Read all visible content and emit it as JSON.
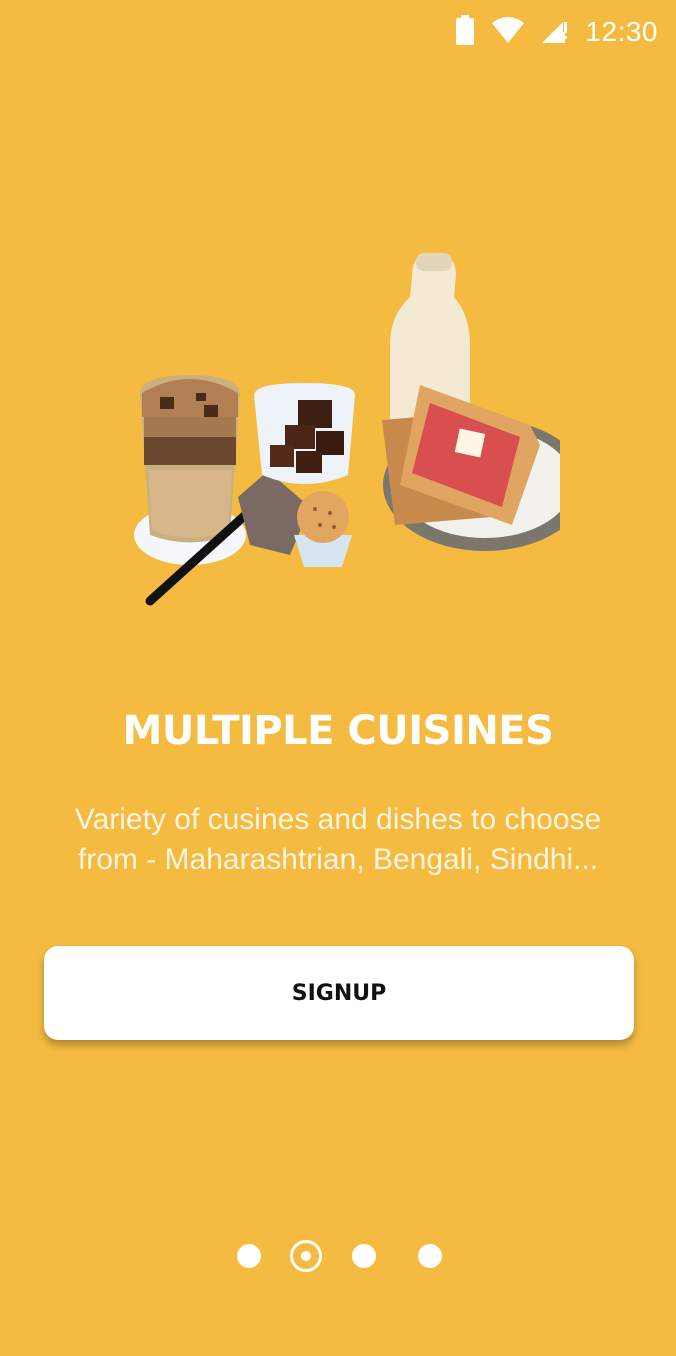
{
  "status_bar": {
    "time": "12:30",
    "icons": [
      "battery-icon",
      "wifi-icon",
      "cellular-signal-icon"
    ]
  },
  "hero": {
    "icon": "food-illustration"
  },
  "onboarding": {
    "title": "MULTIPLE CUISINES",
    "description_line1": "Variety of cusines and dishes to choose",
    "description_line2": "from - Maharashtrian, Bengali, Sindhi..."
  },
  "actions": {
    "signup_label": "SIGNUP"
  },
  "pager": {
    "count": 4,
    "active_index": 1
  },
  "colors": {
    "background": "#F4BB40",
    "button": "#FFFFFF",
    "text_primary": "#FFFFFF"
  }
}
